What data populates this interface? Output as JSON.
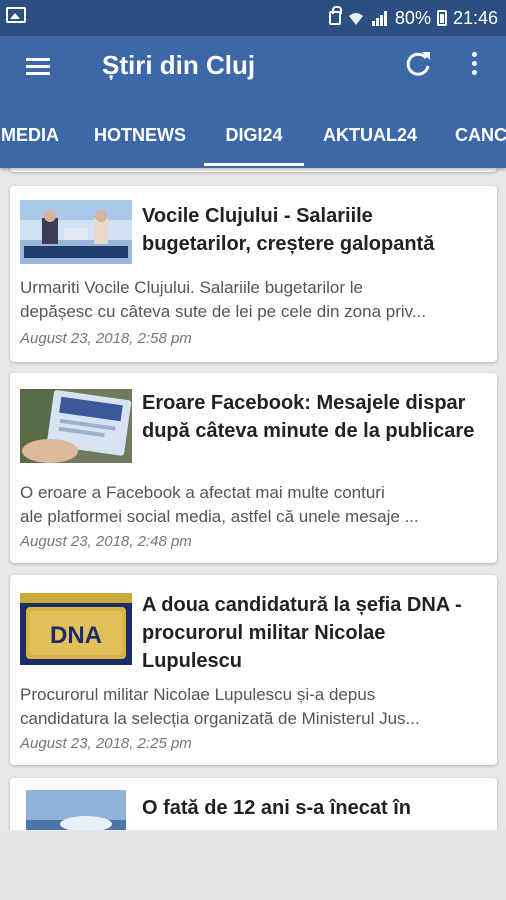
{
  "status_bar": {
    "battery_percent": "80%",
    "time": "21:46",
    "icons": [
      "image-icon",
      "lock-icon",
      "wifi-icon",
      "signal-icon",
      "battery-icon"
    ]
  },
  "toolbar": {
    "title": "Știri din Cluj",
    "icons": [
      "menu-icon",
      "refresh-icon",
      "more-icon"
    ]
  },
  "tabs": [
    {
      "label": "MEDIA"
    },
    {
      "label": "HOTNEWS"
    },
    {
      "label": "DIGI24",
      "active": true
    },
    {
      "label": "AKTUAL24"
    },
    {
      "label": "CANCAN"
    }
  ],
  "articles": [
    {
      "headline": "Vocile Clujului - Salariile bugetarilor, creștere galopantă",
      "summary_line1": "Urmariti Vocile Clujului. Salariile bugetarilor le",
      "summary_line2": "depășesc cu câteva sute de lei pe cele din zona priv...",
      "date": "August 23, 2018, 2:58 pm"
    },
    {
      "headline": "Eroare Facebook: Mesajele dispar după câteva minute de la publicare",
      "summary_line1": "O eroare a Facebook a afectat mai multe conturi",
      "summary_line2": "ale platformei social media, astfel că unele mesaje ...",
      "date": "August 23, 2018, 2:48 pm"
    },
    {
      "headline": "A doua candidatură la șefia DNA - procurorul militar Nicolae Lupulescu",
      "summary_line1": "Procurorul militar Nicolae Lupulescu și-a depus",
      "summary_line2": "candidatura la selecția organizată de Ministerul Jus...",
      "date": "August 23, 2018, 2:25 pm",
      "thumb_text": "DNA"
    },
    {
      "headline": "O fată de 12 ani s-a înecat în"
    }
  ],
  "colors": {
    "status_bar": "#2b4f80",
    "toolbar": "#3c68a8",
    "background": "#e9e9e9"
  }
}
